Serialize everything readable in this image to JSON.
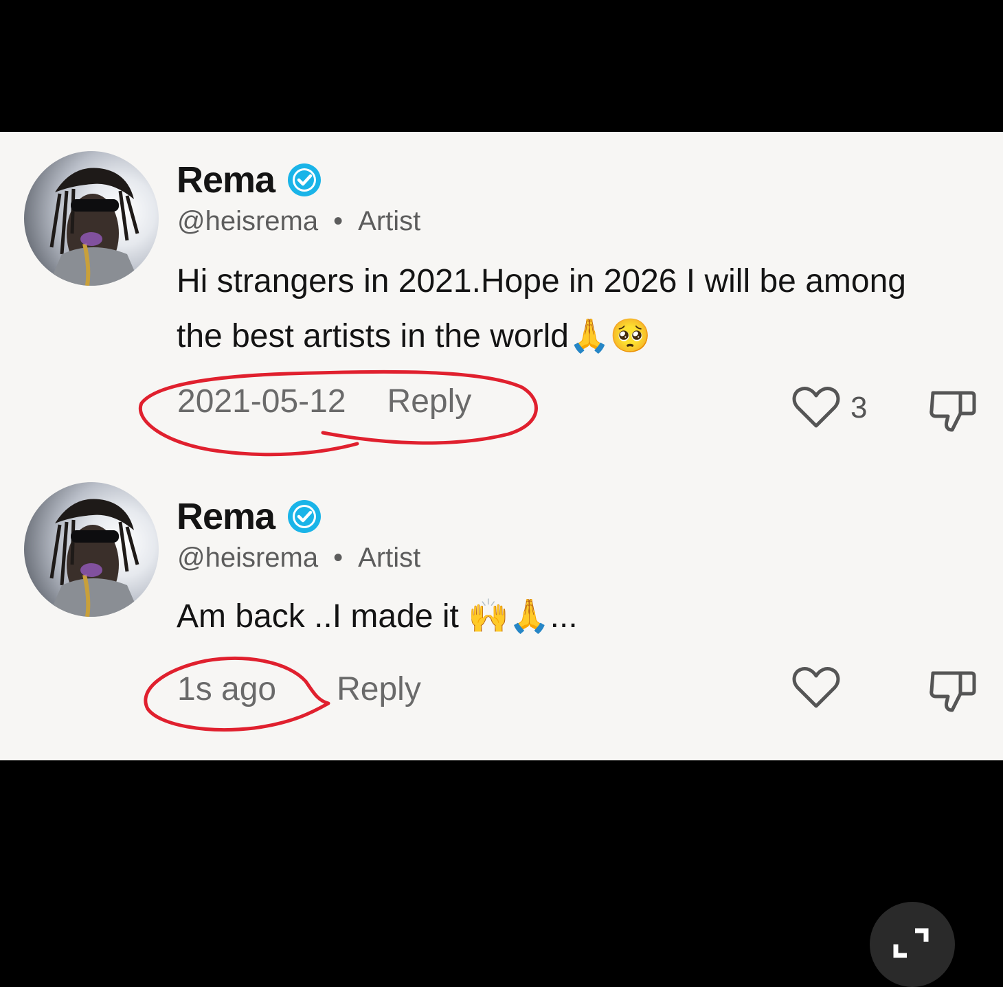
{
  "comments": [
    {
      "author": "Rema",
      "handle": "@heisrema",
      "separator": "•",
      "role": "Artist",
      "text": "Hi strangers in 2021.Hope in 2026 I will be among the best artists in the world🙏🥺",
      "timestamp": "2021-05-12",
      "reply_label": "Reply",
      "like_count": "3"
    },
    {
      "author": "Rema",
      "handle": "@heisrema",
      "separator": "•",
      "role": "Artist",
      "text": "Am back ..I made it 🙌🙏...",
      "timestamp": "1s ago",
      "reply_label": "Reply",
      "like_count": ""
    }
  ],
  "colors": {
    "verified": "#1ab4e8",
    "annotation": "#e0202e",
    "panel_bg": "#f7f6f4",
    "frame_bg": "#000000"
  },
  "icons": [
    "verified-badge-icon",
    "heart-icon",
    "thumbs-down-icon",
    "fullscreen-icon"
  ]
}
